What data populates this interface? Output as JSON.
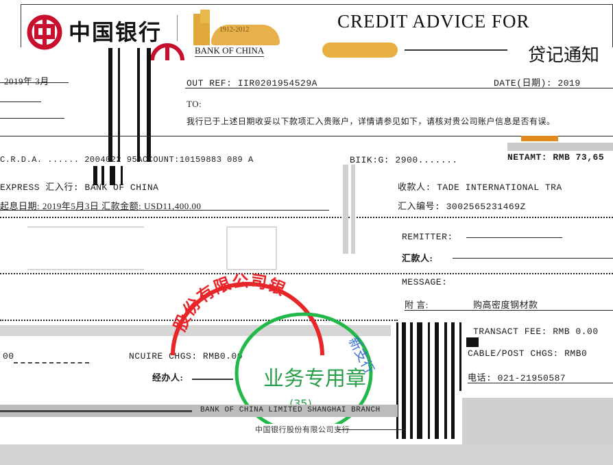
{
  "header": {
    "bank_name_cn": "中国银行",
    "years": "1912-2012",
    "bank_name_en": "BANK OF CHINA",
    "title_en": "CREDIT ADVICE FOR",
    "title_cn": "贷记通知"
  },
  "left_top": {
    "date_label": "2019年 3月"
  },
  "ref": {
    "our_ref": "OUT REF: IIR0201954529A",
    "date": "DATE(日期): 2019",
    "to": "TO:",
    "notice": "我行已于上述日期收妥以下款项汇入贵账户，详情请参见如下，请核对贵公司账户信息是否有误。"
  },
  "amounts": {
    "row1_left": "C.R.D.A. ...... 2004022 95ACCOUNT:10159883 089 A",
    "row1_mid": "BIIK:G: 2900.......",
    "row1_right": "NETAMT: RMB 73,65",
    "remitter_bank": "EXPRESS  汇入行: BANK OF CHINA",
    "receiver": "收款人: TADE INTERNATIONAL TRA",
    "value_date": "起息日期: 2019年5月3日  汇款金额: USD11,400.00",
    "remit_no": "汇入编号: 3002565231469Z",
    "remitter_label": "REMITTER:",
    "remitter_cn": "汇款人:",
    "message_label": "MESSAGE:",
    "message_cn": "附    言:",
    "message_text": "购高密度钢材款"
  },
  "fees": {
    "fee_left": "00",
    "inc_chgs": "NCUIRE CHGS: RMB0.00",
    "handler": "经办人:",
    "transact_fee": "TRANSACT FEE: RMB 0.00",
    "cable_fee": "CABLE/POST CHGS: RMB0",
    "phone": "电话: 021-21950587"
  },
  "stamp": {
    "ring_text": "股份有限公司银",
    "right_text": "新支行",
    "center_text": "业务专用章",
    "number": "(35)"
  },
  "footer": {
    "branch_en": "BANK OF CHINA LIMITED SHANGHAI BRANCH",
    "branch_cn": "中国银行股份有限公司支行"
  }
}
